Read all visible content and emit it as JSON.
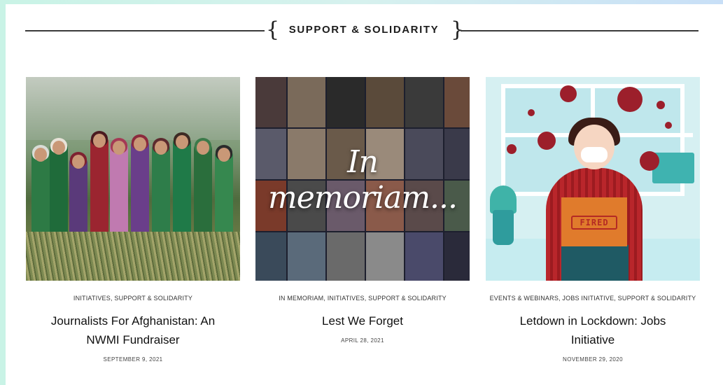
{
  "section": {
    "title": "SUPPORT & SOLIDARITY"
  },
  "posts": [
    {
      "categories": "INITIATIVES, SUPPORT & SOLIDARITY",
      "title": "Journalists For Afghanistan: An NWMI Fundraiser",
      "date": "SEPTEMBER 9, 2021",
      "image": "children-in-field-photo"
    },
    {
      "categories": "IN MEMORIAM, INITIATIVES, SUPPORT & SOLIDARITY",
      "title": "Lest We Forget",
      "date": "APRIL 28, 2021",
      "image": "in-memoriam-collage",
      "overlay_text": "In memoriam..."
    },
    {
      "categories": "EVENTS & WEBINARS, JOBS INITIATIVE, SUPPORT & SOLIDARITY",
      "title": "Letdown in Lockdown: Jobs Initiative",
      "date": "NOVEMBER 29, 2020",
      "image": "fired-worker-illustration",
      "box_label": "FIRED"
    }
  ],
  "colors": {
    "accent_red": "#9c1f2b",
    "illustration_bg": "#d6f0f2",
    "page_gradient_start": "#c9f3e6",
    "page_gradient_end": "#c8dff7"
  }
}
